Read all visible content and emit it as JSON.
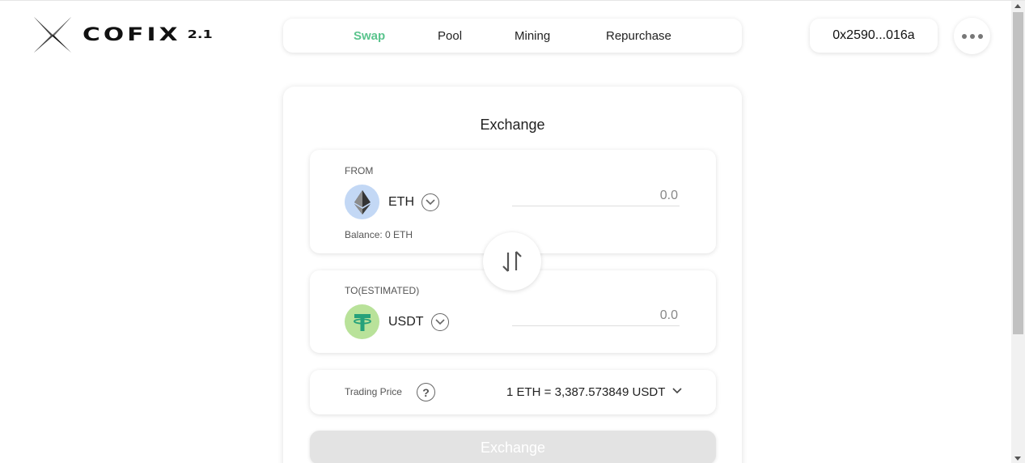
{
  "brand": {
    "name": "COFIX",
    "version": "2.1"
  },
  "nav": {
    "tabs": [
      {
        "label": "Swap",
        "active": true
      },
      {
        "label": "Pool",
        "active": false
      },
      {
        "label": "Mining",
        "active": false
      },
      {
        "label": "Repurchase",
        "active": false
      }
    ]
  },
  "header": {
    "wallet_address": "0x2590...016a",
    "more_icon": "more-horizontal-icon"
  },
  "exchange": {
    "title": "Exchange",
    "from": {
      "label": "FROM",
      "token": "ETH",
      "amount_placeholder": "0.0",
      "balance": "Balance: 0 ETH",
      "icon": "ethereum-icon"
    },
    "to": {
      "label": "TO(ESTIMATED)",
      "token": "USDT",
      "amount_placeholder": "0.0",
      "icon": "tether-icon"
    },
    "trading_price": {
      "label": "Trading Price",
      "value": "1 ETH = 3,387.573849 USDT"
    },
    "submit_label": "Exchange"
  },
  "colors": {
    "accent": "#5ac48d",
    "eth_bg": "#c3d8f5",
    "usdt_bg": "#b9e29a",
    "usdt_fg": "#26a17b",
    "disabled_button": "#e3e3e3"
  }
}
